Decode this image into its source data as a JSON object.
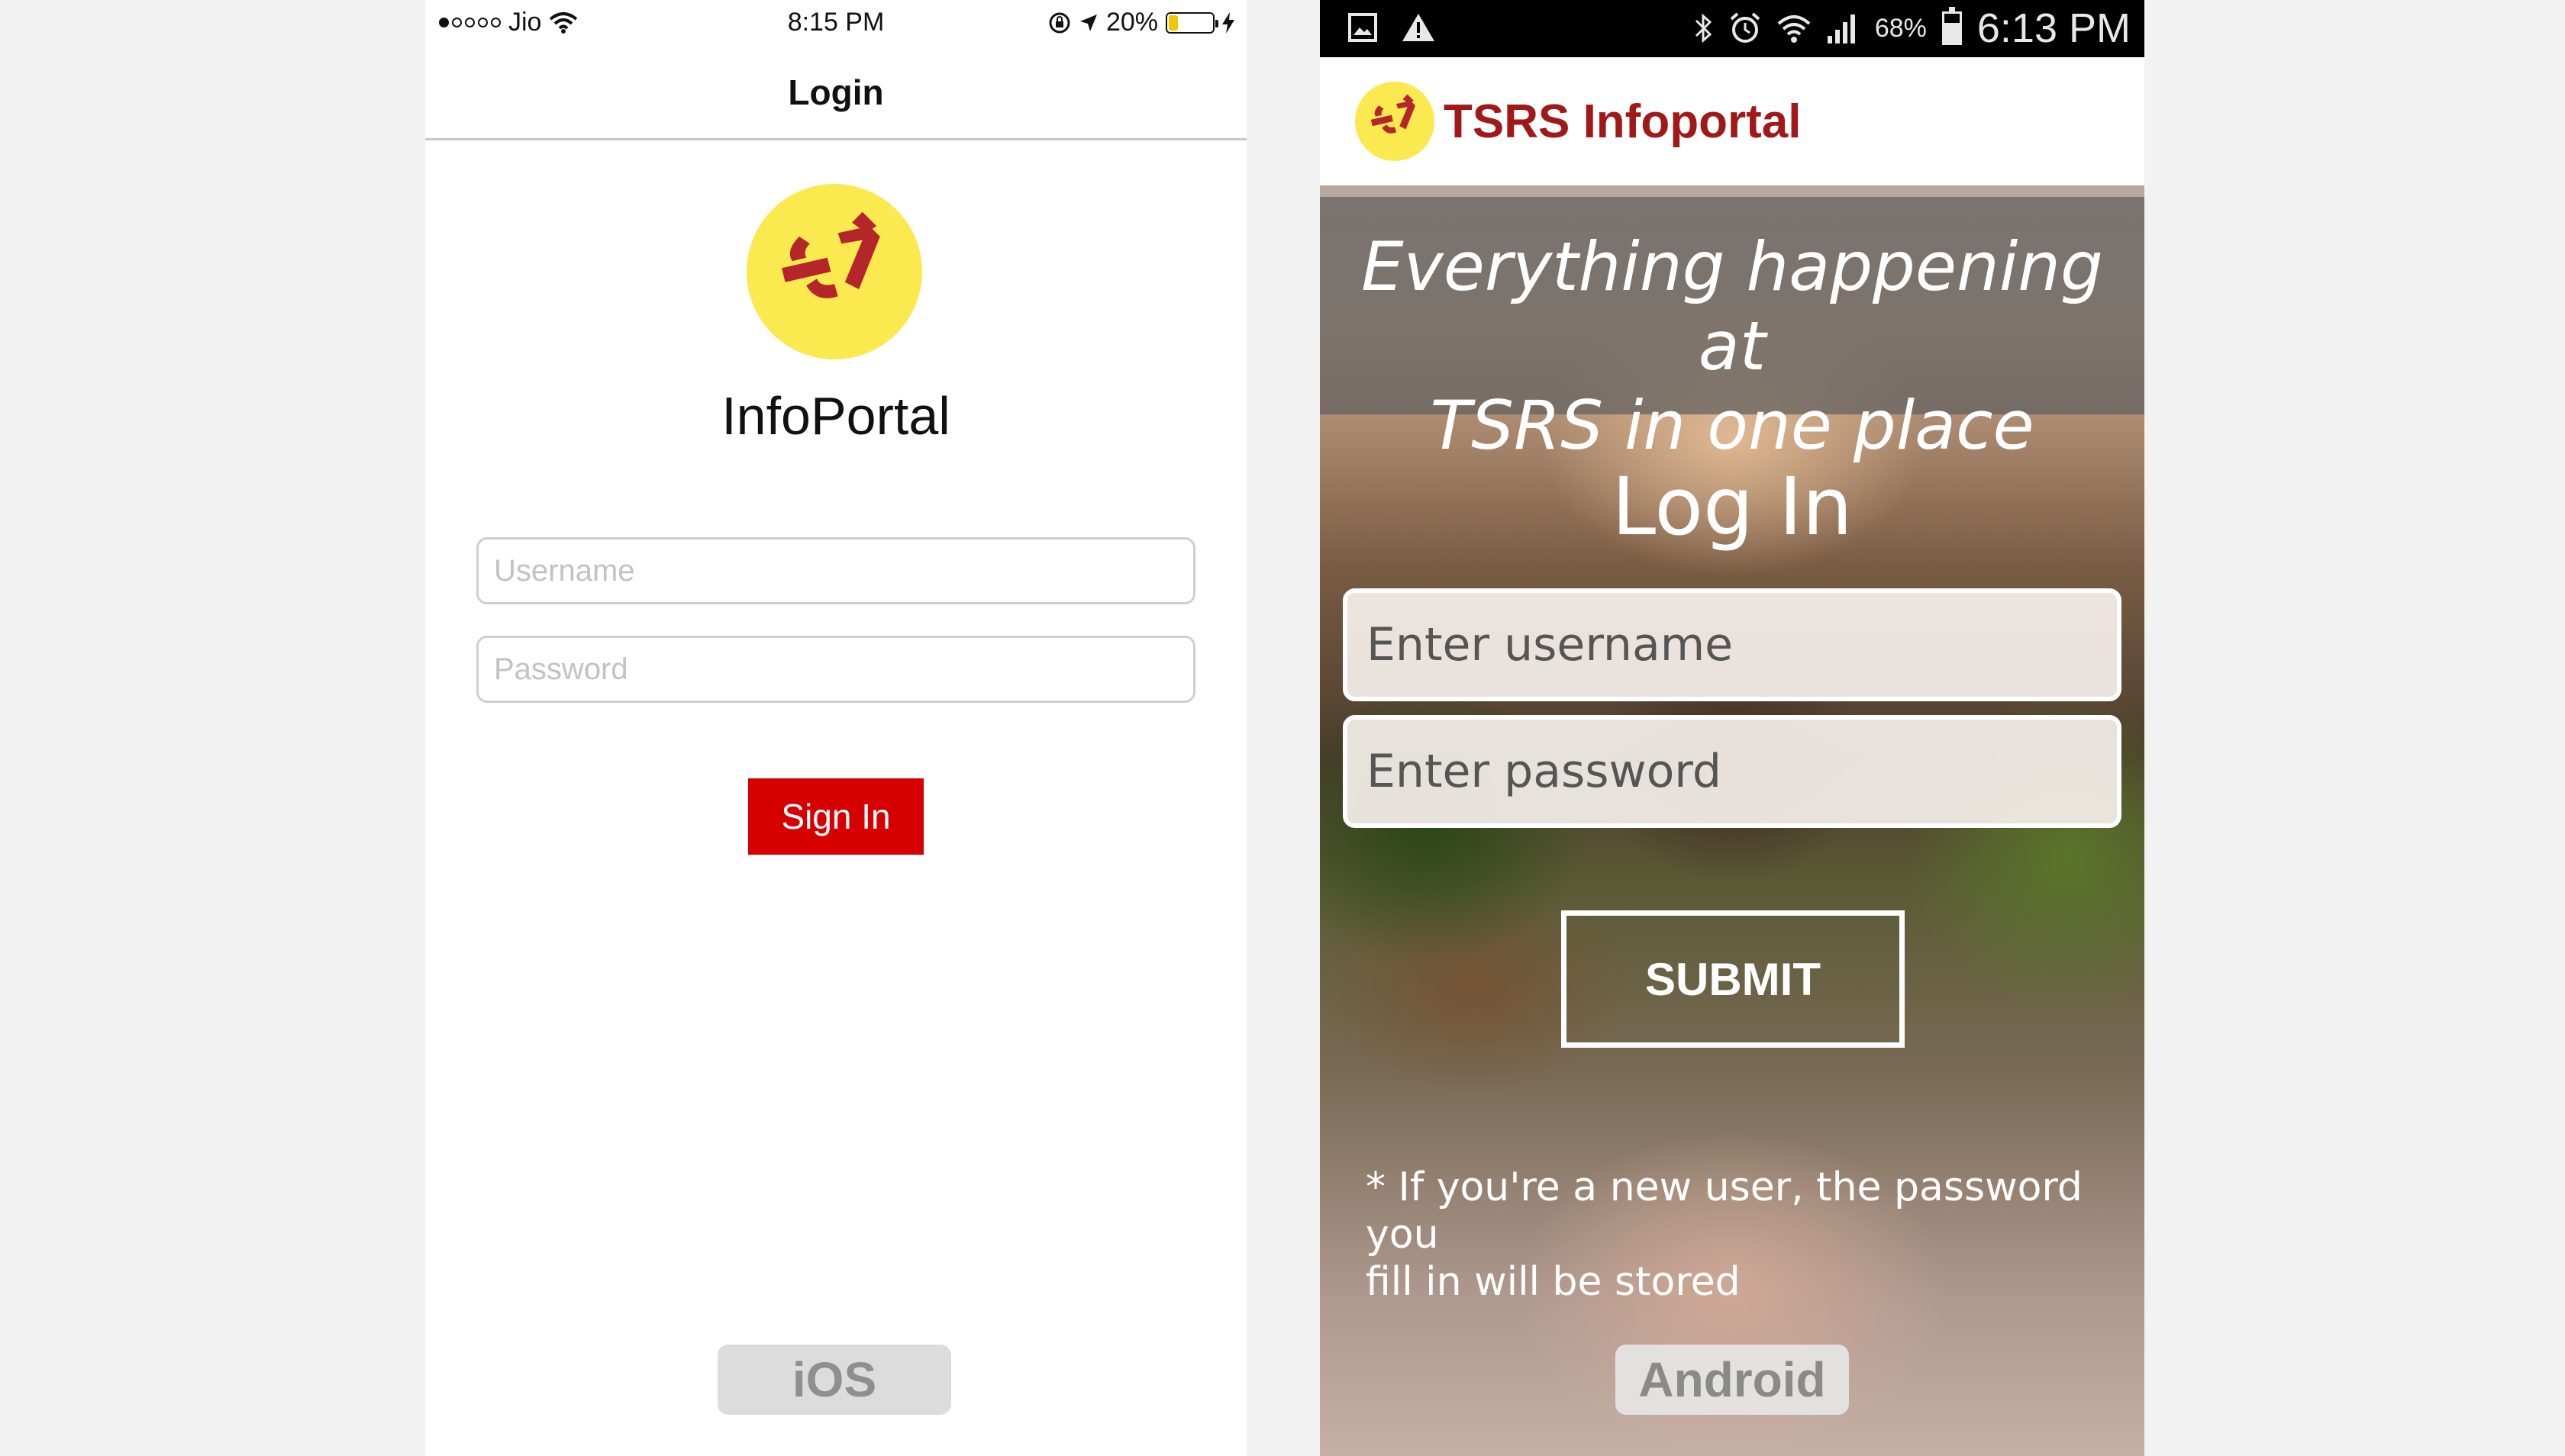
{
  "ios": {
    "status": {
      "carrier": "Jio",
      "time": "8:15 PM",
      "battery": "20%",
      "battery_level": 0.2,
      "signal_bars": 1
    },
    "nav_title": "Login",
    "app_name": "InfoPortal",
    "username_placeholder": "Username",
    "password_placeholder": "Password",
    "signin_label": "Sign In",
    "platform_label": "iOS"
  },
  "android": {
    "status": {
      "battery": "68%",
      "battery_level": 0.68,
      "time": "6:13 PM"
    },
    "app_title": "TSRS Infoportal",
    "banner_line1": "Everything happening at",
    "banner_line2": "TSRS in one place",
    "login_title": "Log In",
    "username_placeholder": "Enter username",
    "password_placeholder": "Enter password",
    "submit_label": "SUBMIT",
    "note_line1": "* If you're a new user, the password you",
    "note_line2": "fill in will be stored",
    "platform_label": "Android"
  },
  "colors": {
    "logo_yellow": "#fbe950",
    "logo_red": "#b5262a",
    "ios_signin_red": "#d60000",
    "android_title_red": "#a11818"
  }
}
